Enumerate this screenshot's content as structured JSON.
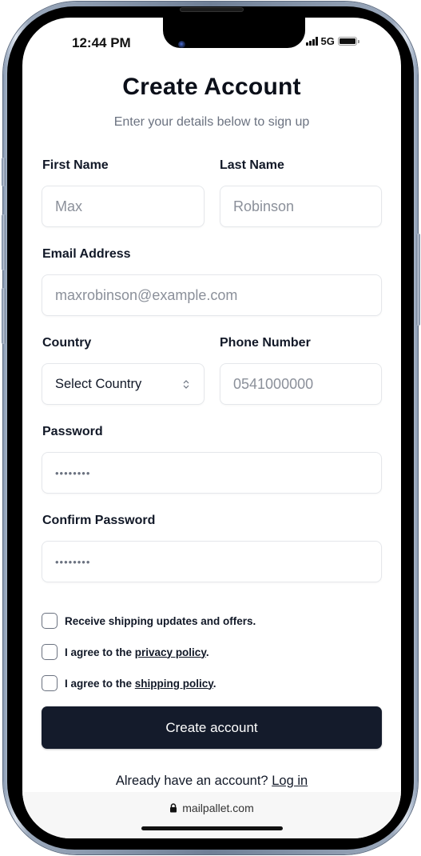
{
  "status_bar": {
    "time": "12:44 PM",
    "network": "5G",
    "signal_icon": "signal-bars-icon",
    "battery_icon": "battery-icon"
  },
  "header": {
    "title": "Create Account",
    "subtitle": "Enter your details below to sign up"
  },
  "form": {
    "first_name": {
      "label": "First Name",
      "placeholder": "Max"
    },
    "last_name": {
      "label": "Last Name",
      "placeholder": "Robinson"
    },
    "email": {
      "label": "Email Address",
      "placeholder": "maxrobinson@example.com"
    },
    "country": {
      "label": "Country",
      "selected": "Select Country",
      "icon": "chevron-up-down-icon"
    },
    "phone": {
      "label": "Phone Number",
      "placeholder": "0541000000"
    },
    "password": {
      "label": "Password",
      "placeholder": "••••••••"
    },
    "confirm_password": {
      "label": "Confirm Password",
      "placeholder": "••••••••"
    },
    "checkboxes": [
      {
        "text": "Receive shipping updates and offers.",
        "checked": false
      },
      {
        "prefix": "I agree to the ",
        "link": "privacy policy",
        "suffix": ".",
        "checked": false
      },
      {
        "prefix": "I agree to the ",
        "link": "shipping policy",
        "suffix": ".",
        "checked": false
      }
    ],
    "submit_label": "Create account",
    "login_prompt": "Already have an account?",
    "login_link": "Log in"
  },
  "browser": {
    "url": "mailpallet.com",
    "lock_icon": "lock-icon"
  },
  "colors": {
    "primary_button": "#141b2b",
    "text_primary": "#111827",
    "text_muted": "#6b7280",
    "input_border": "#e5e7eb"
  }
}
